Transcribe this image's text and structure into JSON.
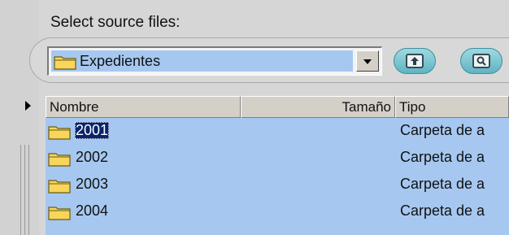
{
  "panel": {
    "title": "Select source files:"
  },
  "location": {
    "value": "Expedientes",
    "folder_icon": "folder-icon",
    "dropdown_icon": "chevron-down-icon"
  },
  "toolbar": {
    "buttons": [
      {
        "name": "up-one-level-button",
        "icon": "up-folder-icon"
      },
      {
        "name": "view-button",
        "icon": "view-icon"
      }
    ]
  },
  "list": {
    "columns": [
      "Nombre",
      "Tamaño",
      "Tipo"
    ],
    "rows": [
      {
        "name": "2001",
        "size": "",
        "type": "Carpeta de a"
      },
      {
        "name": "2002",
        "size": "",
        "type": "Carpeta de a"
      },
      {
        "name": "2003",
        "size": "",
        "type": "Carpeta de a"
      },
      {
        "name": "2004",
        "size": "",
        "type": "Carpeta de a"
      }
    ]
  },
  "colors": {
    "selection": "#a6c8f0",
    "focus": "#0a246a",
    "folder": "#f7d65b",
    "button": "#70c0cc"
  }
}
